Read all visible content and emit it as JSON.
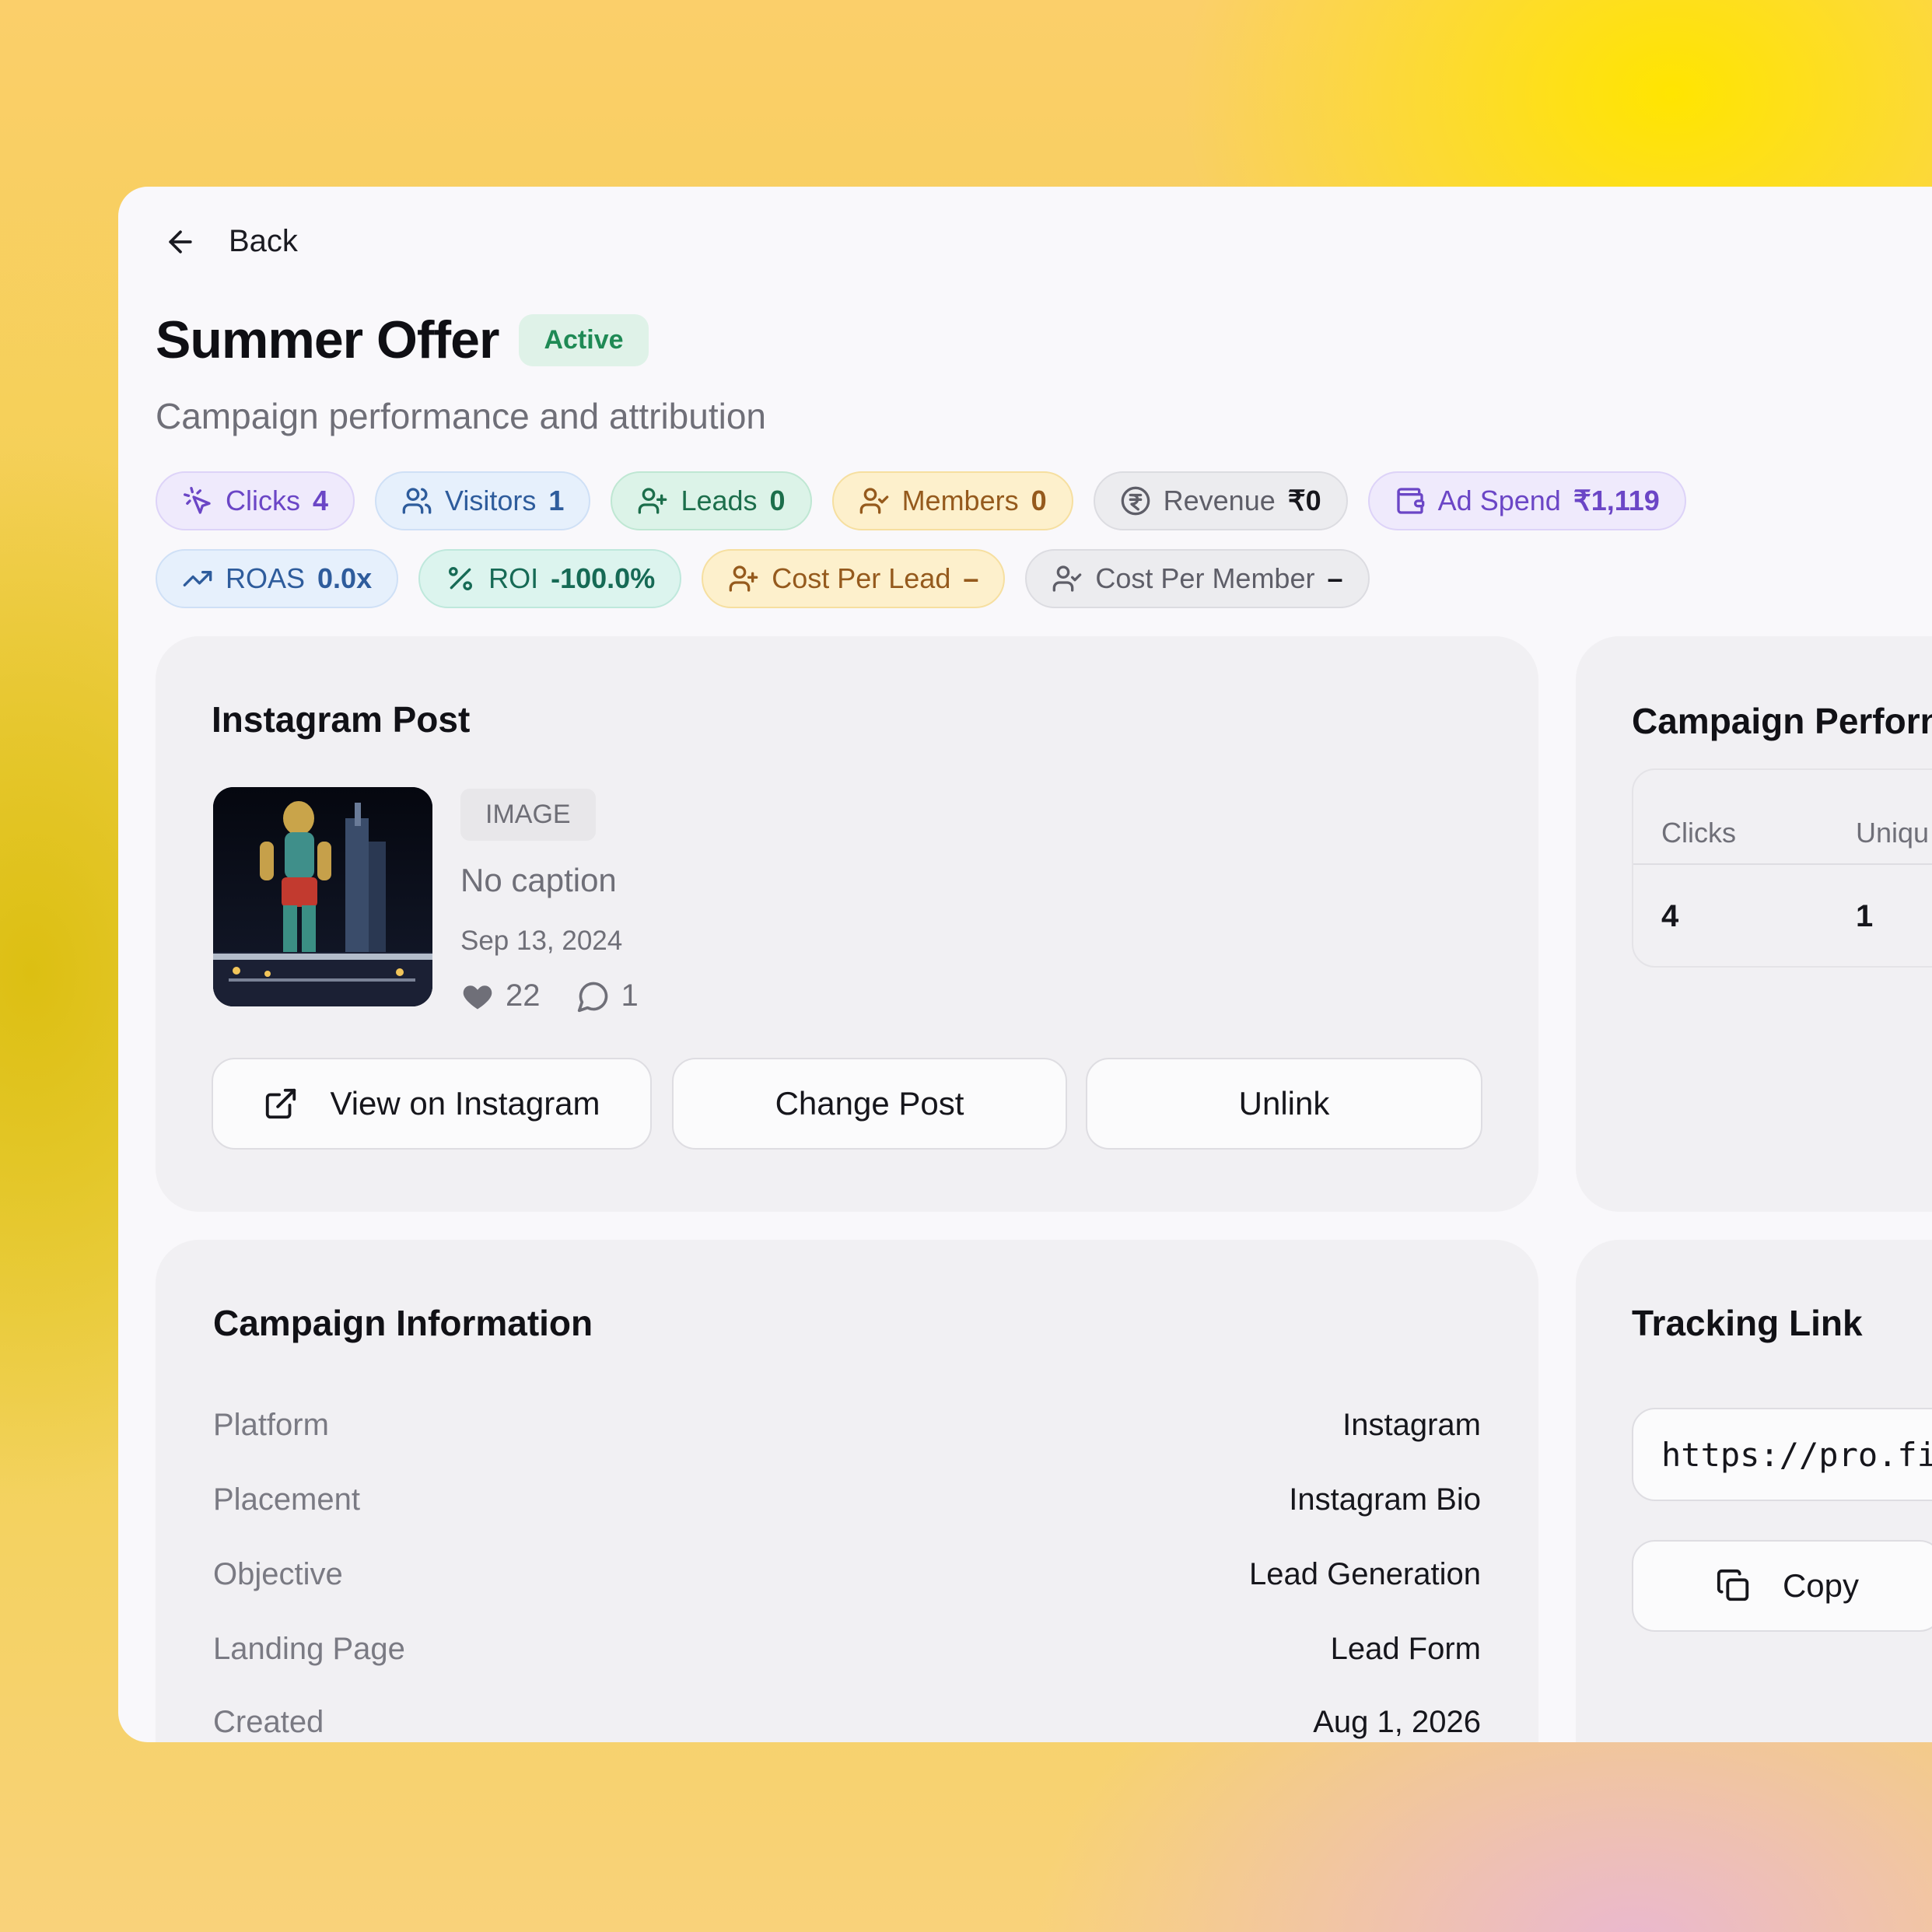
{
  "header": {
    "back_label": "Back",
    "title": "Summer Offer",
    "status": "Active",
    "subtitle": "Campaign performance and attribution"
  },
  "metrics_row1": [
    {
      "label": "Clicks",
      "value": "4",
      "icon": "cursor-click-icon"
    },
    {
      "label": "Visitors",
      "value": "1",
      "icon": "users-icon"
    },
    {
      "label": "Leads",
      "value": "0",
      "icon": "user-plus-icon"
    },
    {
      "label": "Members",
      "value": "0",
      "icon": "user-check-icon"
    },
    {
      "label": "Revenue",
      "value": "₹0",
      "icon": "rupee-circle-icon"
    },
    {
      "label": "Ad Spend",
      "value": "₹1,119",
      "icon": "wallet-icon"
    }
  ],
  "metrics_row2": [
    {
      "label": "ROAS",
      "value": "0.0x",
      "icon": "trending-up-icon"
    },
    {
      "label": "ROI",
      "value": "-100.0%",
      "icon": "percent-icon"
    },
    {
      "label": "Cost Per Lead",
      "value": "–",
      "icon": "user-plus-icon"
    },
    {
      "label": "Cost Per Member",
      "value": "–",
      "icon": "user-check-icon"
    }
  ],
  "instagram_post": {
    "title": "Instagram Post",
    "media_type": "IMAGE",
    "caption": "No caption",
    "date": "Sep 13, 2024",
    "likes": "22",
    "comments": "1",
    "buttons": {
      "view": "View on Instagram",
      "change": "Change Post",
      "unlink": "Unlink"
    }
  },
  "performance": {
    "title": "Campaign Perforn",
    "headers": [
      "Clicks",
      "Uniqu"
    ],
    "values": [
      "4",
      "1"
    ]
  },
  "campaign_info": {
    "title": "Campaign Information",
    "rows": [
      {
        "label": "Platform",
        "value": "Instagram"
      },
      {
        "label": "Placement",
        "value": "Instagram Bio"
      },
      {
        "label": "Objective",
        "value": "Lead Generation"
      },
      {
        "label": "Landing Page",
        "value": "Lead Form"
      },
      {
        "label": "Created",
        "value": "Aug 1, 2026"
      }
    ]
  },
  "tracking": {
    "title": "Tracking Link",
    "url": "https://pro.fi",
    "copy_label": "Copy"
  },
  "colors": {
    "active_green": "#1f8a55",
    "clicks_purple": "#6b46c6",
    "visitors_blue": "#2e5c9c",
    "leads_green": "#1c6e4b",
    "members_amber": "#955a1d"
  }
}
